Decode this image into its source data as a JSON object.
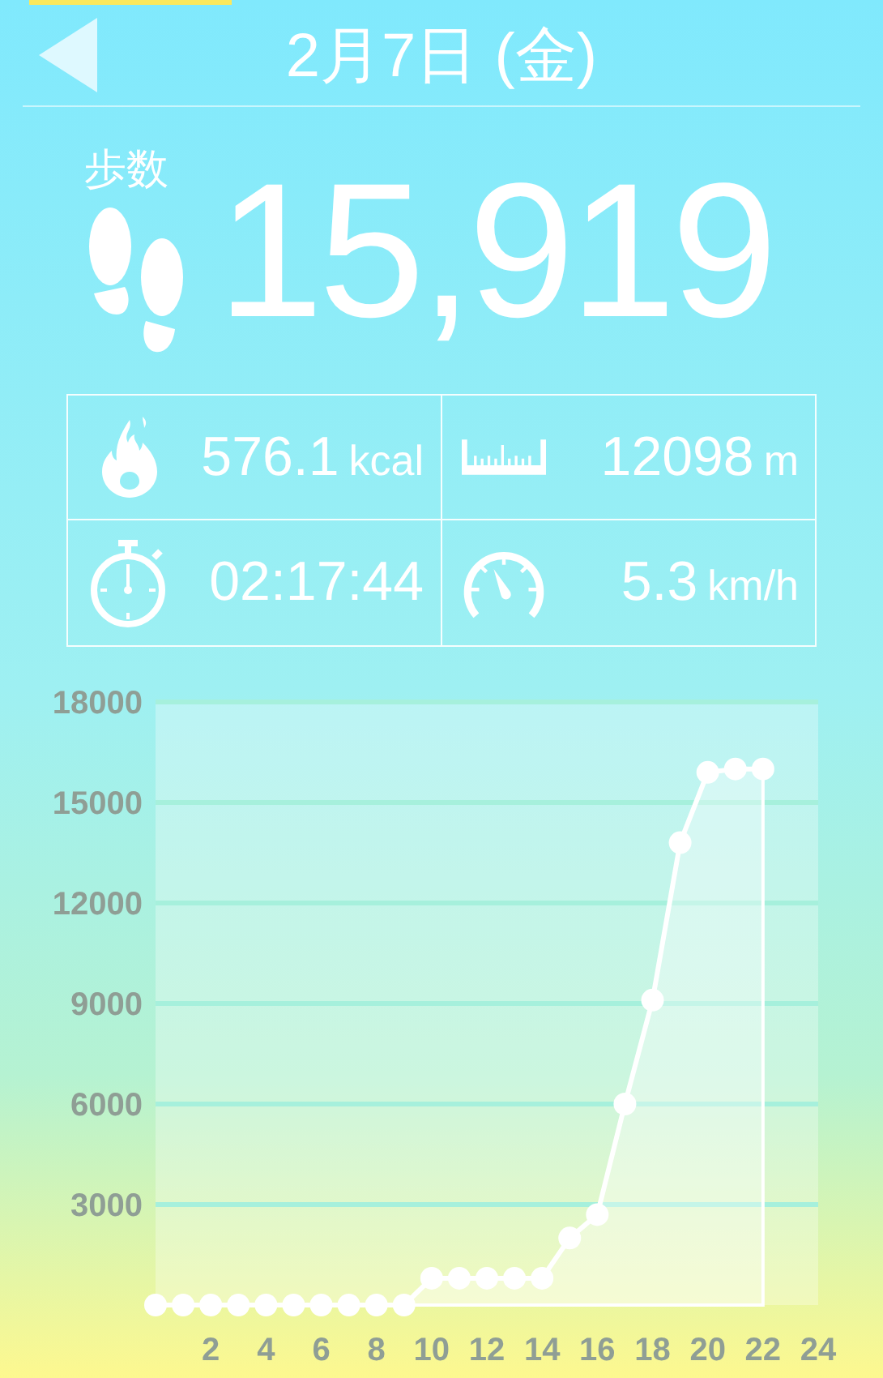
{
  "header": {
    "title": "2月7日 (金)"
  },
  "steps": {
    "label": "歩数",
    "value": "15,919"
  },
  "stats": [
    {
      "kind": "calories",
      "value": "576.1",
      "unit": "kcal"
    },
    {
      "kind": "distance",
      "value": "12098",
      "unit": "m"
    },
    {
      "kind": "duration",
      "value": "02:17:44"
    },
    {
      "kind": "speed",
      "value": "5.3",
      "unit": "km/h"
    }
  ],
  "chart": {
    "chart_data": {
      "type": "area",
      "x": [
        0,
        1,
        2,
        3,
        4,
        5,
        6,
        7,
        8,
        9,
        10,
        11,
        12,
        13,
        14,
        15,
        16,
        17,
        18,
        19,
        20,
        21,
        22
      ],
      "series": [
        {
          "color": "#ffffff",
          "values": [
            0,
            0,
            0,
            0,
            0,
            0,
            0,
            0,
            0,
            0,
            800,
            800,
            800,
            800,
            800,
            2000,
            2700,
            6000,
            9100,
            13800,
            15900,
            16000,
            16000
          ]
        }
      ],
      "grid": true,
      "xlim": [
        0,
        24
      ],
      "ylim": [
        0,
        18000
      ],
      "xticks": [
        2,
        4,
        6,
        8,
        10,
        12,
        14,
        16,
        18,
        20,
        22,
        24
      ],
      "yticks": [
        3000,
        6000,
        9000,
        12000,
        15000,
        18000
      ]
    }
  }
}
